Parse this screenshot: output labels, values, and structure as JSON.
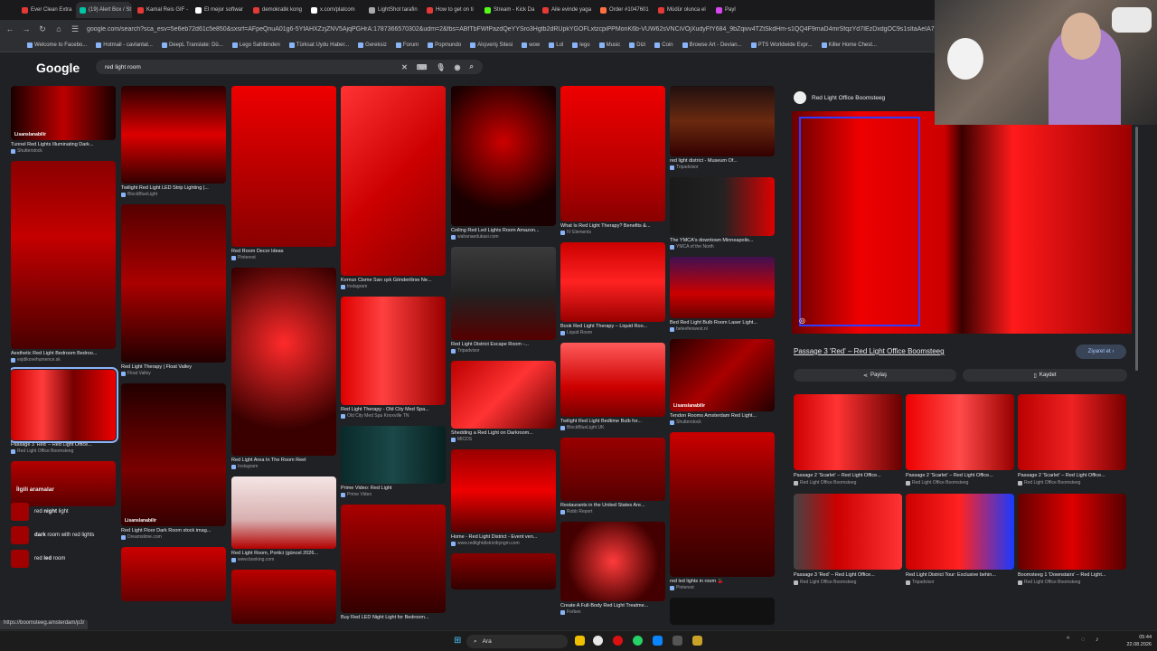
{
  "browser": {
    "tabs": [
      {
        "label": "Ever Clean Extra",
        "color": "#e53935"
      },
      {
        "label": "(19) Alert Box / St",
        "color": "#00c4a7",
        "active": true
      },
      {
        "label": "Kamal Reis GIF -",
        "color": "#e53935"
      },
      {
        "label": "El mejor softwar",
        "color": "#ffffff"
      },
      {
        "label": "demokratik kong",
        "color": "#e53935"
      },
      {
        "label": "x.com/platcom",
        "color": "#ffffff"
      },
      {
        "label": "LightShot tarafin",
        "color": "#aaaaaa"
      },
      {
        "label": "How to get on ti",
        "color": "#e53935"
      },
      {
        "label": "Stream - Kick Da",
        "color": "#53fc18"
      },
      {
        "label": "Aile evinde yaga",
        "color": "#e53935"
      },
      {
        "label": "Order #1047601",
        "color": "#ff7043"
      },
      {
        "label": "Müdür olunca el",
        "color": "#e53935"
      },
      {
        "label": "Payl",
        "color": "#d946ef"
      }
    ],
    "url": "google.com/search?sca_esv=5e6eb72d61c5e850&sxsrf=AFpeQnuA01g6-5YfAHXZzjZNV5AjqPGHrA:1787366570302&udm=2&fbs=ABfTbFWfPazdQeYYSro3Hgtb2dRUpkYGOFLxtzcpiPPMonK6b-VUW62sVNCiVOjXudyFfY684_9bZqivv4TZtSkdHm-s1QQ4F9maD4mrSfqzYd7IEzDxdgOC9s1sItaAeIA7-RYw2o",
    "bookmarks": [
      "Welcome to Facebo...",
      "Hotmail - cavlantat...",
      "DeepL Translate: Dü...",
      "Lego Sahibinden",
      "Türksat Uydu Haber...",
      "Gereksiz",
      "Forum",
      "Popmundo",
      "Alışveriş Sitesi",
      "wow",
      "Lol",
      "lego",
      "Music",
      "Dizi",
      "Coin",
      "Browse Art - Devian...",
      "PTS Worldwide Expr...",
      "Killer Home Chest..."
    ],
    "status_url": "https://boomsteeg.amsterdam/p3/"
  },
  "google": {
    "logo": "Google",
    "query": "red light room",
    "icons": [
      "close-icon",
      "keyboard-icon",
      "mic-icon",
      "lens-icon",
      "search-icon"
    ]
  },
  "results": {
    "columns": [
      [
        {
          "title": "Tunnel Red Lights Illuminating Dark...",
          "source": "Shutterstock",
          "h": 60,
          "badge": "Lisanslanabilir",
          "bg": "linear-gradient(90deg,#1a0000,#b00,#1a0000)"
        },
        {
          "title": "Aesthetic Red Light Bedroom Bedroo...",
          "source": "esjdikovehumence.sk",
          "h": 208,
          "bg": "linear-gradient(180deg,#8a0000,#c40000 40%,#4a0000)"
        },
        {
          "title": "Passage 3 'Red' – Red Light Office...",
          "source": "Red Light Office Boomsteeg",
          "h": 78,
          "bg": "linear-gradient(90deg,#c00,#ff3b3b 30%,#700 60%,#e00)",
          "selected": true
        },
        {
          "title": "",
          "source": "",
          "h": 50,
          "bg": "linear-gradient(180deg,#b30000,#5a0000)"
        }
      ],
      [
        {
          "title": "Twilight Red Light LED Strip Lighting |...",
          "source": "BlockBlueLight",
          "h": 108,
          "bg": "linear-gradient(180deg,#2a0000,#d00 50%,#300)"
        },
        {
          "title": "Red Light Therapy | Float Valley",
          "source": "Float Valley",
          "h": 175,
          "bg": "linear-gradient(180deg,#500,#a00 50%,#200)"
        },
        {
          "title": "Red Light Floor Dark Room stock imag...",
          "source": "Dreamstime.com",
          "h": 158,
          "badge": "Lisanslanabilir",
          "bg": "linear-gradient(180deg,#200,#7a0000 60%,#300)"
        },
        {
          "title": "",
          "source": "",
          "h": 60,
          "bg": "linear-gradient(180deg,#c00,#600)"
        }
      ],
      [
        {
          "title": "Red Room Decor Ideas",
          "source": "Pinterest",
          "h": 178,
          "bg": "linear-gradient(180deg,#e00,#8a0000)"
        },
        {
          "title": "Red Light Area In The Room Reel",
          "source": "Instagram",
          "h": 208,
          "bg": "radial-gradient(circle at 50% 40%,#ff2a2a,#3a0000 70%)"
        },
        {
          "title": "Red Light Room, Portici (güncel 2026...",
          "source": "www.booking.com",
          "h": 80,
          "bg": "linear-gradient(180deg,#f5e5e5,#d8b0b0 60%,#b30000)"
        },
        {
          "title": "",
          "source": "",
          "h": 60,
          "bg": "linear-gradient(180deg,#b00,#400)"
        }
      ],
      [
        {
          "title": "Kırmızı Cisme Sarı ışık Gönderilirse Ne...",
          "source": "Instagram",
          "h": 210,
          "bg": "linear-gradient(135deg,#f33,#c00 50%,#8a0000)"
        },
        {
          "title": "Red Light Therapy - Old City Med Spa...",
          "source": "Old City Med Spa Knoxville TN",
          "h": 120,
          "bg": "linear-gradient(90deg,#d00,#ff4040 40%,#900)"
        },
        {
          "title": "Prime Video: Red Light",
          "source": "Prime Video",
          "h": 64,
          "bg": "linear-gradient(90deg,#0a2a2a,#1b4848 50%,#082020)"
        },
        {
          "title": "Buy Red LED Night Light for Bedroom...",
          "source": "",
          "h": 120,
          "bg": "linear-gradient(180deg,#a00,#300)"
        }
      ],
      [
        {
          "title": "Ceiling Red Led Lights Room Amazon...",
          "source": "wahanaedukasi.com",
          "h": 155,
          "bg": "radial-gradient(circle at 50% 40%,#c00,#1a0000 70%)"
        },
        {
          "title": "Red Light District Escape Room -...",
          "source": "Tripadvisor",
          "h": 103,
          "bg": "linear-gradient(180deg,#3a3a3a,#222 50%,#550000)"
        },
        {
          "title": "Shedding a Red Light on Darkroom...",
          "source": "MICDS",
          "h": 75,
          "bg": "linear-gradient(135deg,#b00,#f33 50%,#600)"
        },
        {
          "title": "Home - Red Light District - Event ven...",
          "source": "www.redlightdistrictbyngm.com",
          "h": 92,
          "bg": "linear-gradient(180deg,#900,#e00 50%,#500)"
        },
        {
          "title": "",
          "source": "",
          "h": 40,
          "bg": "linear-gradient(180deg,#800,#300)"
        }
      ],
      [
        {
          "title": "What Is Red Light Therapy? Benefits &...",
          "source": "IV Elements",
          "h": 150,
          "bg": "linear-gradient(180deg,#e00,#b00 60%,#8a0000)"
        },
        {
          "title": "Book Red Light Therapy – Liquid Roo...",
          "source": "Liquid Room",
          "h": 88,
          "bg": "linear-gradient(180deg,#c00,#f22 50%,#900)"
        },
        {
          "title": "Twilight Red Light Bedtime Bulb for...",
          "source": "BlockBlueLight UK",
          "h": 82,
          "bg": "linear-gradient(180deg,#ff5a5a,#c00 60%,#700)"
        },
        {
          "title": "Restaurants in the United States Are...",
          "source": "Robb Report",
          "h": 70,
          "bg": "linear-gradient(180deg,#900,#500)"
        },
        {
          "title": "Create A Full-Body Red Light Treatme...",
          "source": "Forbes",
          "h": 88,
          "bg": "radial-gradient(circle at 50% 50%,#ff3b3b,#400 70%)"
        }
      ],
      [
        {
          "title": "red light district - Museum Of...",
          "source": "Tripadvisor",
          "h": 78,
          "bg": "linear-gradient(180deg,#201010,#6a2a10 50%,#300)"
        },
        {
          "title": "The YMCA's downtown Minneapolis...",
          "source": "YMCA of the North",
          "h": 65,
          "bg": "linear-gradient(90deg,#1a1a1a,#222 50%,#d00)"
        },
        {
          "title": "Bed Red Light Bulb Room Laser Light...",
          "source": "beleefenwest.nl",
          "h": 68,
          "bg": "linear-gradient(180deg,#401050,#c00 60%,#600)"
        },
        {
          "title": "Tendon Rooms Amsterdam Red Light...",
          "source": "Shutterstock",
          "h": 80,
          "badge": "Lisanslanabilir",
          "bg": "linear-gradient(135deg,#2a0000,#a00 50%,#200)"
        },
        {
          "title": "red led lights in room 🍒",
          "source": "Pinterest",
          "h": 160,
          "bg": "linear-gradient(180deg,#c00,#600 50%,#300)"
        },
        {
          "title": "",
          "source": "",
          "h": 30,
          "bg": "#111"
        }
      ]
    ]
  },
  "related": {
    "heading": "İlgili aramalar",
    "items": [
      {
        "pre": "red ",
        "bold": "night",
        "post": " light"
      },
      {
        "pre": "",
        "bold": "dark",
        "post": " room with red lights"
      },
      {
        "pre": "red ",
        "bold": "led",
        "post": " room"
      }
    ]
  },
  "panel": {
    "source_name": "Red Light Office Boomsteeg",
    "title": "Passage 3 'Red' – Red Light Office Boomsteeg",
    "visit_label": "Ziyaret et",
    "share_label": "Paylaş",
    "save_label": "Kaydet",
    "grid": [
      {
        "label": "Passage 2 'Scarlet' – Red Light Office...",
        "source": "Red Light Office Boomsteeg",
        "bg": "linear-gradient(90deg,#c00,#f33 40%,#600)"
      },
      {
        "label": "Passage 2 'Scarlet' – Red Light Office...",
        "source": "Red Light Office Boomsteeg",
        "bg": "linear-gradient(90deg,#e00,#ff4a4a 50%,#900)"
      },
      {
        "label": "Passage 2 'Scarlet' – Red Light Office...",
        "source": "Red Light Office Boomsteeg",
        "bg": "linear-gradient(90deg,#b00,#e22 50%,#700)"
      },
      {
        "label": "Passage 3 'Red' – Red Light Office...",
        "source": "Red Light Office Boomsteeg",
        "bg": "linear-gradient(90deg,#444,#c00 40%,#f33)"
      },
      {
        "label": "Red Light District Tour: Exclusive behin...",
        "source": "Tripadvisor",
        "bg": "linear-gradient(90deg,#c00,#f22 50%,#1a3aff)"
      },
      {
        "label": "Boomsteeg 1 'Downstairs' – Red Light...",
        "source": "Red Light Office Boomsteeg",
        "bg": "linear-gradient(90deg,#600,#d00 50%,#500)"
      }
    ]
  },
  "taskbar": {
    "search_label": "Ara",
    "time": "05:44",
    "date": "22.08.2026"
  }
}
